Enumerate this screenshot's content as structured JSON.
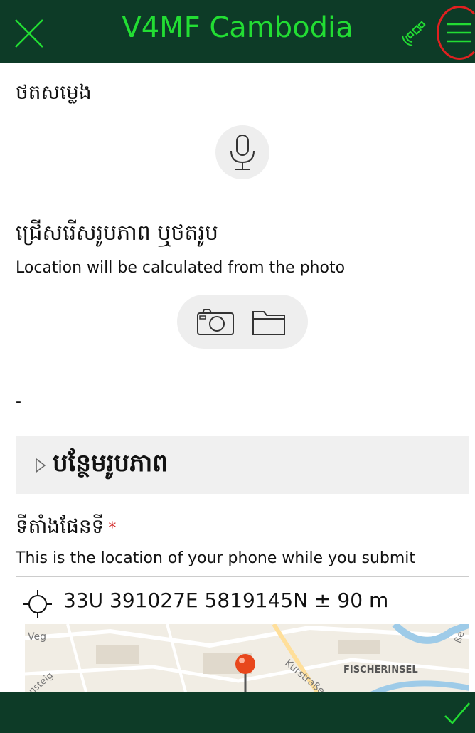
{
  "header": {
    "title": "V4MF Cambodia",
    "close_icon": "close-icon",
    "gps_icon": "gps-satellite-icon",
    "menu_icon": "hamburger-menu-icon",
    "bar_color": "#0d3b27",
    "title_color": "#22dd33"
  },
  "voice": {
    "heading": "ថតសម្លេង",
    "icon": "microphone-icon"
  },
  "photo": {
    "heading": "ជ្រើសរើសរូបភាព ឬថតរូប",
    "note": "Location will be calculated from the photo",
    "camera_icon": "camera-icon",
    "folder_icon": "folder-icon"
  },
  "separator_text": "-",
  "add_photo": {
    "label": "បន្ថែមរូបភាព",
    "icon": "expand-triangle-icon"
  },
  "location": {
    "heading": "ទីតាំងផែនទី",
    "required_mark": "*",
    "note": "This is the location of your phone while you submit",
    "coordinates": "33U 391027E 5819145N ± 90 m",
    "target_icon": "crosshair-icon",
    "map": {
      "labels": [
        "Veg",
        "nsteig",
        "Kurstraße",
        "FISCHERINSEL",
        "ße"
      ],
      "marker_icon": "map-pin-icon"
    }
  },
  "footer": {
    "confirm_icon": "checkmark-icon",
    "accent": "#22dd33"
  }
}
